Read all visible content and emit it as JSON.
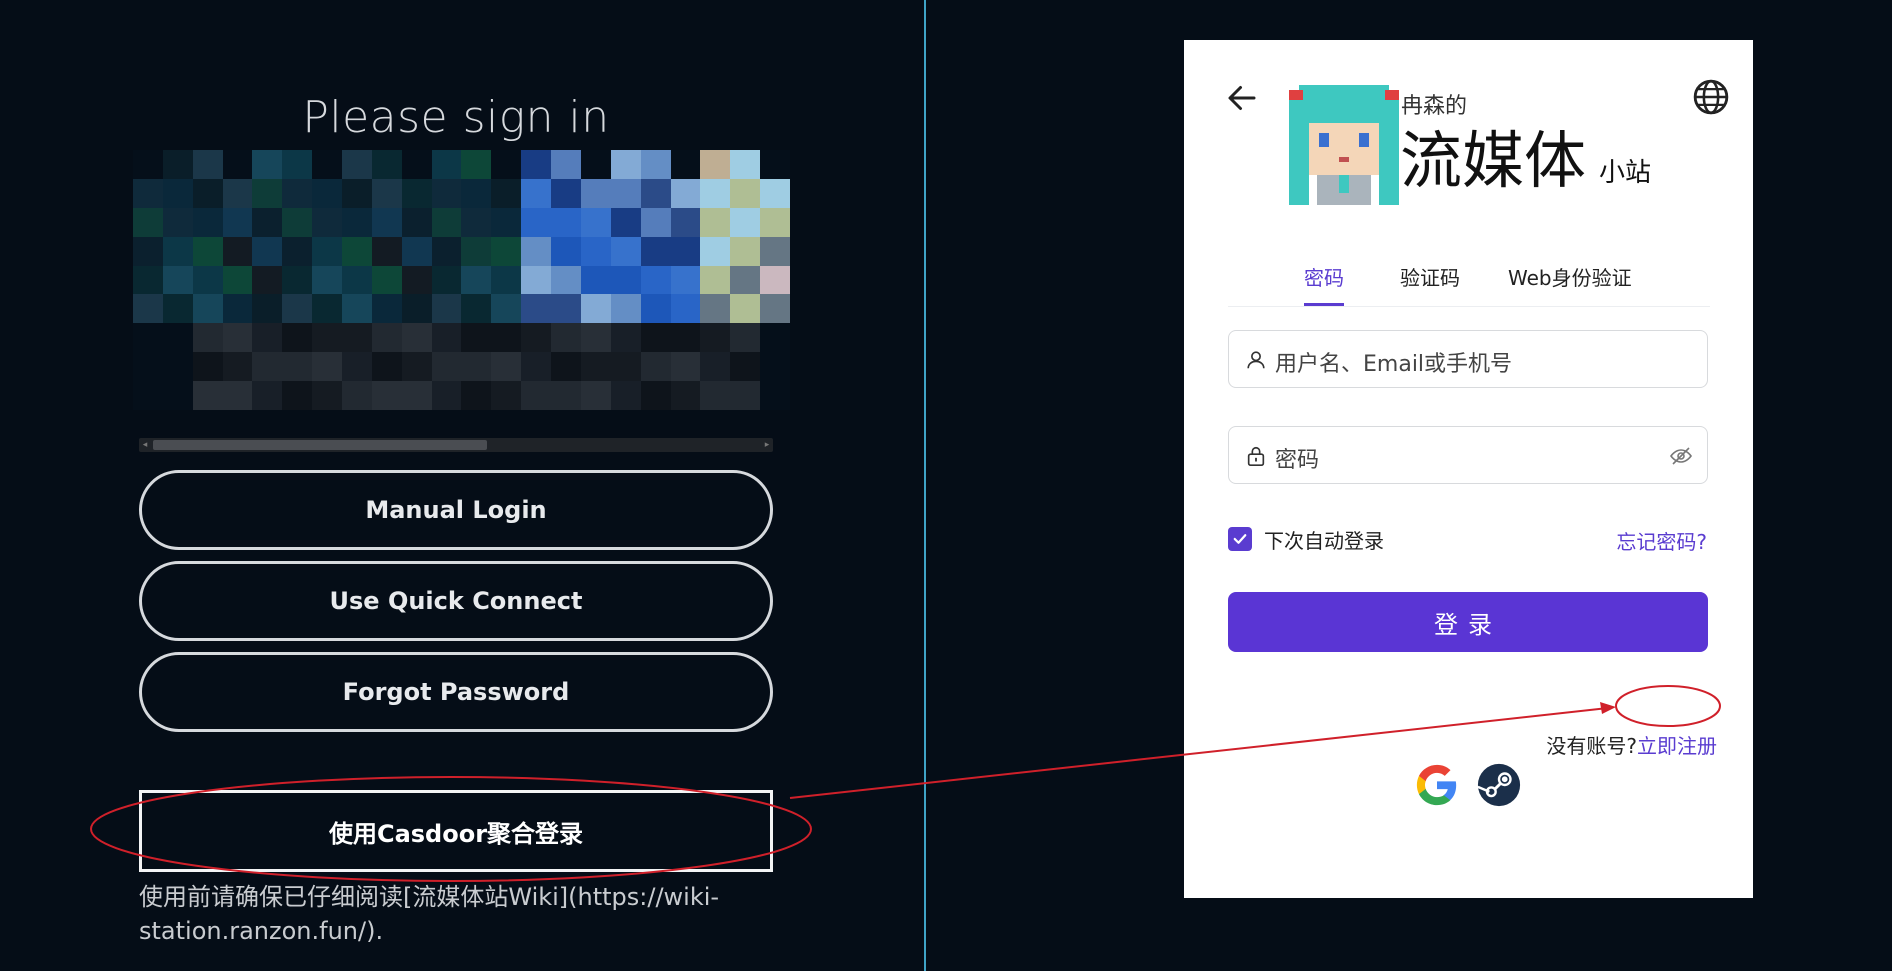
{
  "left": {
    "title": "Please sign in",
    "buttons": {
      "manual_login": "Manual Login",
      "quick_connect": "Use Quick Connect",
      "forgot_password": "Forgot Password",
      "casdoor": "使用Casdoor聚合登录"
    },
    "note": "使用前请确保已仔细阅读[流媒体站Wiki](https://wiki-station.ranzon.fun/)."
  },
  "card": {
    "logo": {
      "owner": "冉森的",
      "main": "流媒体",
      "sub": "小站"
    },
    "tabs": [
      "密码",
      "验证码",
      "Web身份验证"
    ],
    "active_tab": "密码",
    "username_placeholder": "用户名、Email或手机号",
    "password_placeholder": "密码",
    "remember_label": "下次自动登录",
    "remember_checked": true,
    "forgot_link": "忘记密码?",
    "login_button": "登录",
    "no_account": "没有账号?",
    "signup_link": "立即注册",
    "providers": [
      "google-icon",
      "steam-icon"
    ],
    "accent": "#5a3cd0"
  },
  "colors": {
    "background": "#050d17",
    "divider": "#3fa3c7",
    "annotation": "#d0202a"
  }
}
